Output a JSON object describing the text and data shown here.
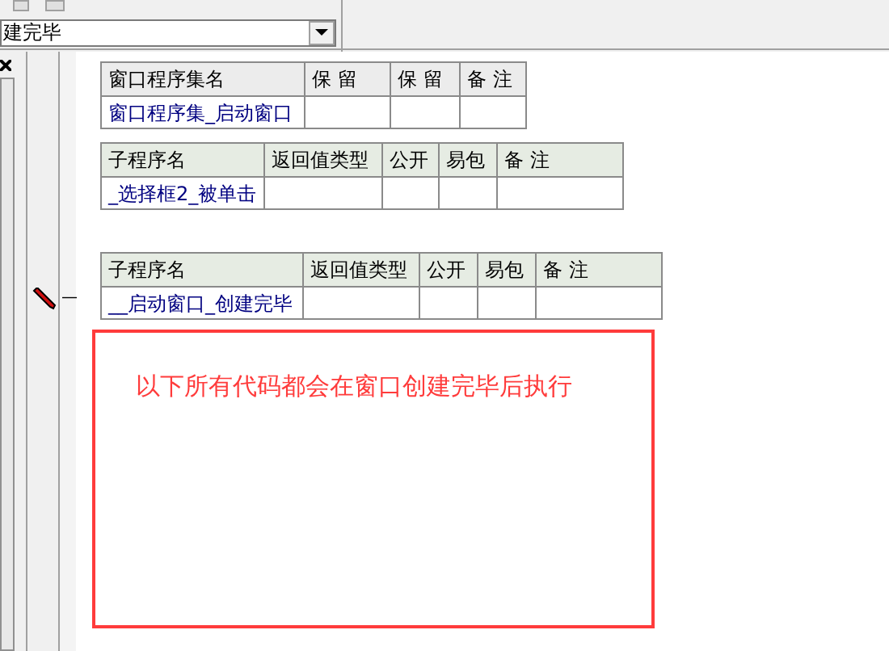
{
  "dropdown": {
    "value": "建完毕"
  },
  "tables": [
    {
      "columns": [
        "窗口程序集名",
        "保 留",
        "保 留",
        "备 注"
      ],
      "cells": [
        "窗口程序集_启动窗口",
        "",
        "",
        ""
      ],
      "kind": "assembly"
    },
    {
      "columns": [
        "子程序名",
        "返回值类型",
        "公开",
        "易包",
        "备 注"
      ],
      "cells": [
        "_选择框2_被单击",
        "",
        "",
        "",
        ""
      ],
      "kind": "sub"
    },
    {
      "columns": [
        "子程序名",
        "返回值类型",
        "公开",
        "易包",
        "备 注"
      ],
      "cells": [
        "__启动窗口_创建完毕",
        "",
        "",
        "",
        ""
      ],
      "kind": "sub",
      "marker": "—"
    }
  ],
  "note": "以下所有代码都会在窗口创建完毕后执行"
}
